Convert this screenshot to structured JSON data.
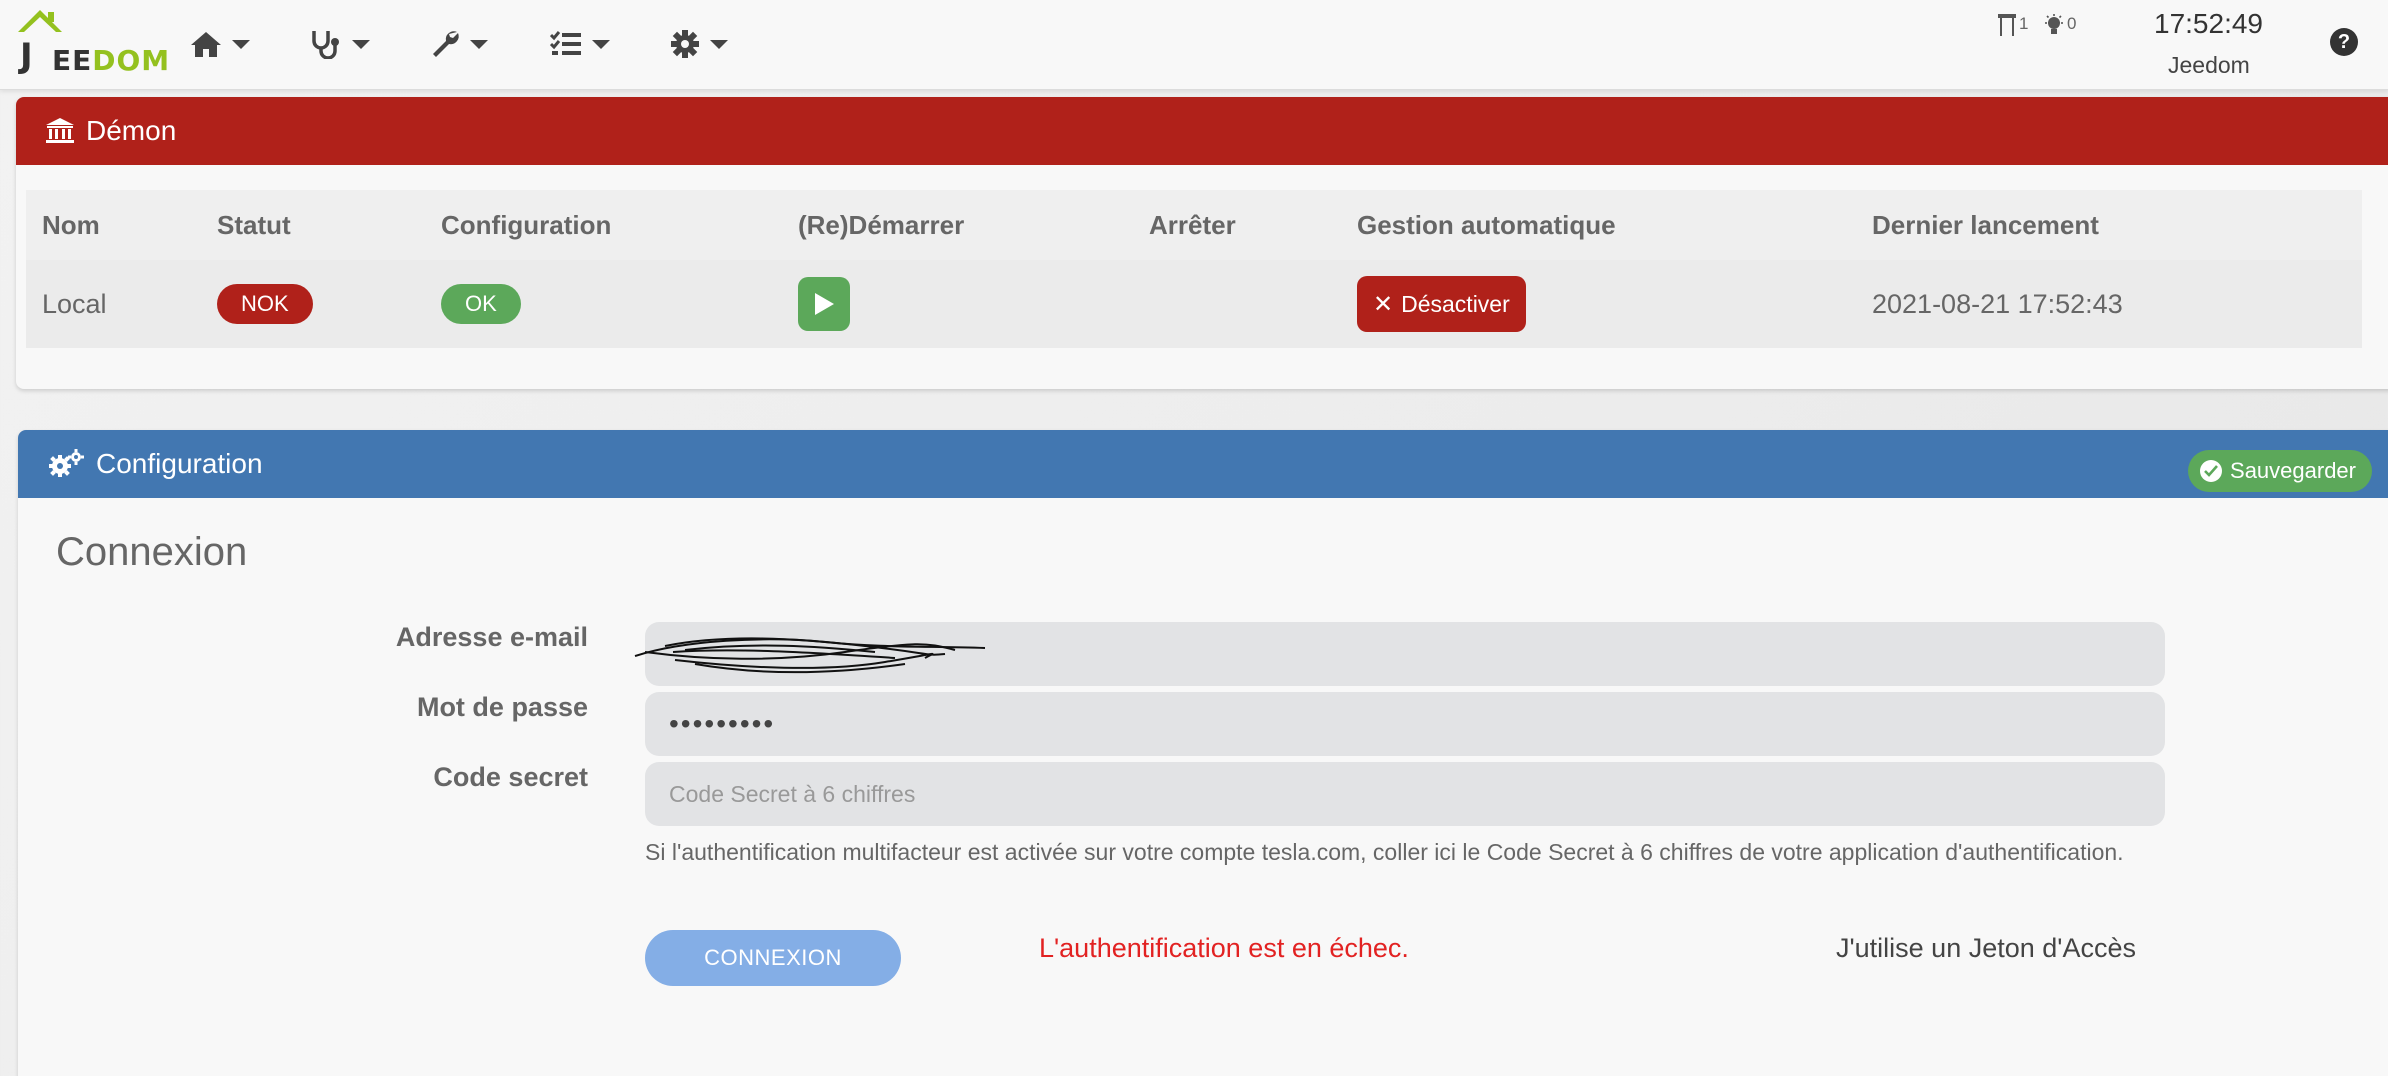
{
  "app": {
    "logo_text_j": "J",
    "logo_text_ee": "EE",
    "logo_text_dom": "DOM",
    "brand_green": "#94c11f"
  },
  "navbar": {
    "menus": [
      {
        "icon": "home-icon"
      },
      {
        "icon": "stethoscope-icon"
      },
      {
        "icon": "wrench-icon"
      },
      {
        "icon": "tasks-icon"
      },
      {
        "icon": "gear-icon"
      }
    ],
    "shutter_count": "1",
    "light_count": "0",
    "time": "17:52:49",
    "user": "Jeedom",
    "help_label": "?"
  },
  "demon": {
    "title": "Démon",
    "header_color": "#b0211a",
    "columns": [
      "Nom",
      "Statut",
      "Configuration",
      "(Re)Démarrer",
      "Arrêter",
      "Gestion automatique",
      "Dernier lancement"
    ],
    "row": {
      "name": "Local",
      "status": "NOK",
      "configuration": "OK",
      "auto_button": "Désactiver",
      "last_launch": "2021-08-21 17:52:43"
    }
  },
  "config": {
    "title": "Configuration",
    "header_color": "#4277b1",
    "save_label": "Sauvegarder",
    "section": "Connexion",
    "email_label": "Adresse e-mail",
    "password_label": "Mot de passe",
    "password_value": "•••••••••",
    "secret_label": "Code secret",
    "secret_placeholder": "Code Secret à 6 chiffres",
    "help_text": "Si l'authentification multifacteur est activée sur votre compte tesla.com, coller ici le Code Secret à 6 chiffres de votre application d'authentification.",
    "connect_button": "CONNEXION",
    "auth_error": "L'authentification est en échec.",
    "token_link": "J'utilise un Jeton d'Accès"
  }
}
